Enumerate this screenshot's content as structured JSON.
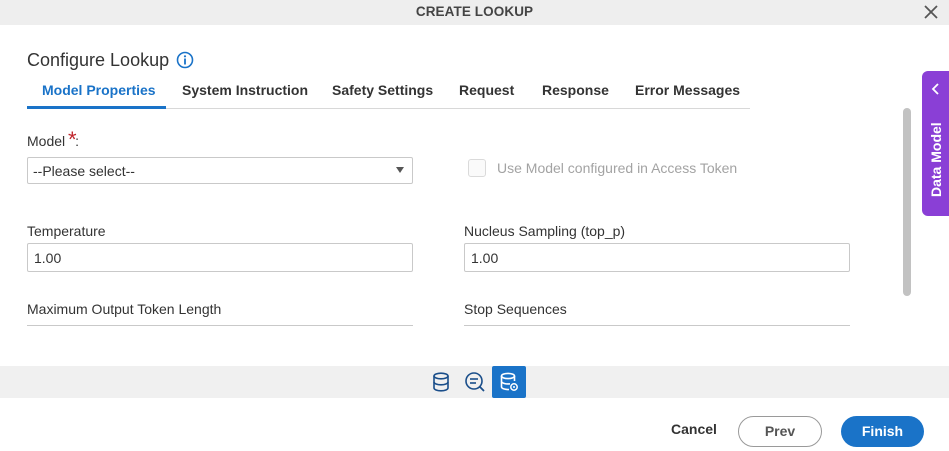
{
  "dialog": {
    "title": "CREATE LOOKUP",
    "close_icon": "close-icon"
  },
  "page": {
    "heading": "Configure Lookup",
    "info_icon": "info-icon"
  },
  "tabs": [
    {
      "label": "Model Properties",
      "active": true
    },
    {
      "label": "System Instruction",
      "active": false
    },
    {
      "label": "Safety Settings",
      "active": false
    },
    {
      "label": "Request",
      "active": false
    },
    {
      "label": "Response",
      "active": false
    },
    {
      "label": "Error Messages",
      "active": false
    }
  ],
  "form": {
    "model": {
      "label": "Model",
      "required_marker": "*",
      "colon": ":",
      "selected": "--Please select--"
    },
    "use_access_token_model": {
      "label": "Use Model configured in Access Token",
      "checked": false,
      "disabled": true
    },
    "temperature": {
      "label": "Temperature",
      "value": "1.00"
    },
    "nucleus_sampling": {
      "label": "Nucleus Sampling (top_p)",
      "value": "1.00"
    },
    "max_output_tokens": {
      "label": "Maximum Output Token Length",
      "value": ""
    },
    "stop_sequences": {
      "label": "Stop Sequences",
      "value": ""
    }
  },
  "side_panel": {
    "label": "Data Model",
    "icon": "chevron-left-icon"
  },
  "bottom_icons": [
    {
      "name": "database-icon",
      "active": false
    },
    {
      "name": "search-list-icon",
      "active": false
    },
    {
      "name": "database-settings-icon",
      "active": true
    }
  ],
  "footer": {
    "cancel": "Cancel",
    "prev": "Prev",
    "finish": "Finish"
  },
  "colors": {
    "accent": "#1a73c8",
    "side_panel": "#8a3fd6",
    "required": "#c0262d"
  }
}
